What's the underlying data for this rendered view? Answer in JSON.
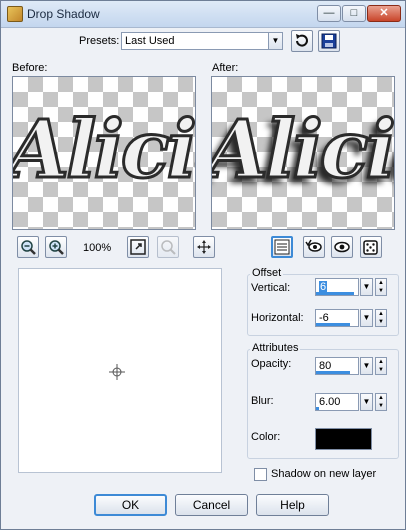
{
  "window": {
    "title": "Drop Shadow"
  },
  "presets": {
    "label": "Presets:",
    "value": "Last Used"
  },
  "previews": {
    "before_label": "Before:",
    "after_label": "After:",
    "sample_text": "Alicia"
  },
  "zoom": {
    "level": "100%"
  },
  "offset": {
    "group_label": "Offset",
    "vertical_label": "Vertical:",
    "vertical_value": "6",
    "horizontal_label": "Horizontal:",
    "horizontal_value": "-6"
  },
  "attributes": {
    "group_label": "Attributes",
    "opacity_label": "Opacity:",
    "opacity_value": "80",
    "blur_label": "Blur:",
    "blur_value": "6.00",
    "color_label": "Color:",
    "color_value": "#000000"
  },
  "shadow_on_new_layer": {
    "label": "Shadow on new layer",
    "checked": false
  },
  "buttons": {
    "ok": "OK",
    "cancel": "Cancel",
    "help": "Help"
  }
}
